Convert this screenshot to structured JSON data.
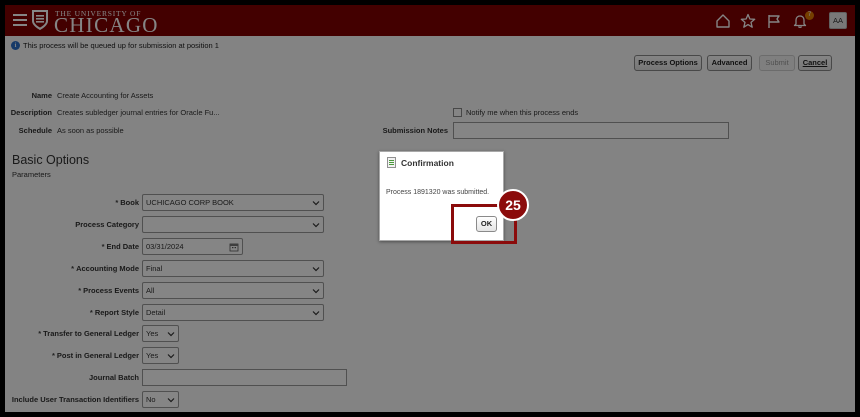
{
  "header": {
    "logo_line1": "THE UNIVERSITY OF",
    "logo_line2": "CHICAGO",
    "notification_count": "7",
    "avatar_initials": "AA",
    "color": "#800000"
  },
  "info_message": "This process will be queued up for submission at position 1",
  "toolbar": {
    "process_options": "Process Options",
    "advanced": "Advanced",
    "submit": "Submit",
    "cancel": "Cancel"
  },
  "summary": {
    "name_label": "Name",
    "name_value": "Create Accounting for Assets",
    "description_label": "Description",
    "description_value": "Creates subledger journal entries for Oracle Fu...",
    "schedule_label": "Schedule",
    "schedule_value": "As soon as possible",
    "notify_label": "Notify me when this process ends",
    "submission_notes_label": "Submission Notes",
    "submission_notes_value": ""
  },
  "basic_options": {
    "title": "Basic Options",
    "subtitle": "Parameters"
  },
  "params": {
    "book_label": "Book",
    "book_value": "UCHICAGO CORP BOOK",
    "process_category_label": "Process Category",
    "process_category_value": "",
    "end_date_label": "End Date",
    "end_date_value": "03/31/2024",
    "accounting_mode_label": "Accounting Mode",
    "accounting_mode_value": "Final",
    "process_events_label": "Process Events",
    "process_events_value": "All",
    "report_style_label": "Report Style",
    "report_style_value": "Detail",
    "transfer_gl_label": "Transfer to General Ledger",
    "transfer_gl_value": "Yes",
    "post_gl_label": "Post in General Ledger",
    "post_gl_value": "Yes",
    "journal_batch_label": "Journal Batch",
    "journal_batch_value": "",
    "user_txn_label": "Include User Transaction Identifiers",
    "user_txn_value": "No"
  },
  "dialog": {
    "title": "Confirmation",
    "message": "Process 1891320 was submitted.",
    "ok": "OK"
  },
  "callout": {
    "step": "25",
    "color": "#8b0b0b"
  }
}
